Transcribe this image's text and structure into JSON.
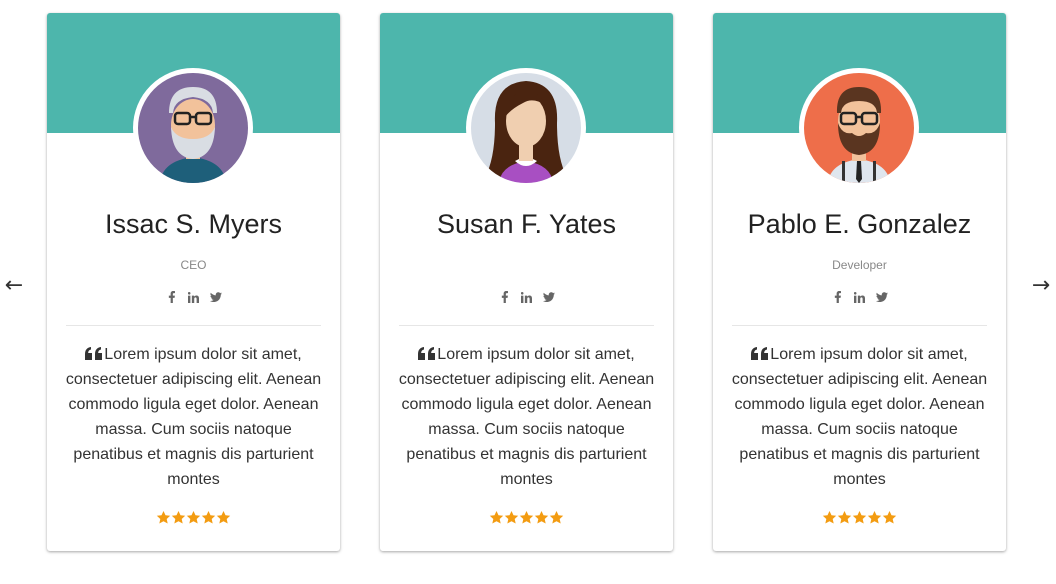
{
  "theme": {
    "accent": "#4db6ac",
    "star_color": "#f39c12"
  },
  "nav": {
    "prev_icon": "arrow-left-icon",
    "next_icon": "arrow-right-icon",
    "prev_glyph": "←",
    "next_glyph": "→"
  },
  "cards": [
    {
      "name": "Issac S. Myers",
      "role": "CEO",
      "avatar": "old-man-avatar",
      "avatar_bg": "#7f6a9c",
      "quote": "Lorem ipsum dolor sit amet, consectetuer adipiscing elit. Aenean commodo ligula eget dolor. Aenean massa. Cum sociis natoque penatibus et magnis dis parturient montes",
      "rating": 5
    },
    {
      "name": "Susan F. Yates",
      "role": "",
      "avatar": "woman-avatar",
      "avatar_bg": "#d6dde6",
      "quote": "Lorem ipsum dolor sit amet, consectetuer adipiscing elit. Aenean commodo ligula eget dolor. Aenean massa. Cum sociis natoque penatibus et magnis dis parturient montes",
      "rating": 5
    },
    {
      "name": "Pablo E. Gonzalez",
      "role": "Developer",
      "avatar": "bearded-man-avatar",
      "avatar_bg": "#ee6e4a",
      "quote": "Lorem ipsum dolor sit amet, consectetuer adipiscing elit. Aenean commodo ligula eget dolor. Aenean massa. Cum sociis natoque penatibus et magnis dis parturient montes",
      "rating": 5
    }
  ],
  "social_icons": [
    "facebook-icon",
    "linkedin-icon",
    "twitter-icon"
  ]
}
